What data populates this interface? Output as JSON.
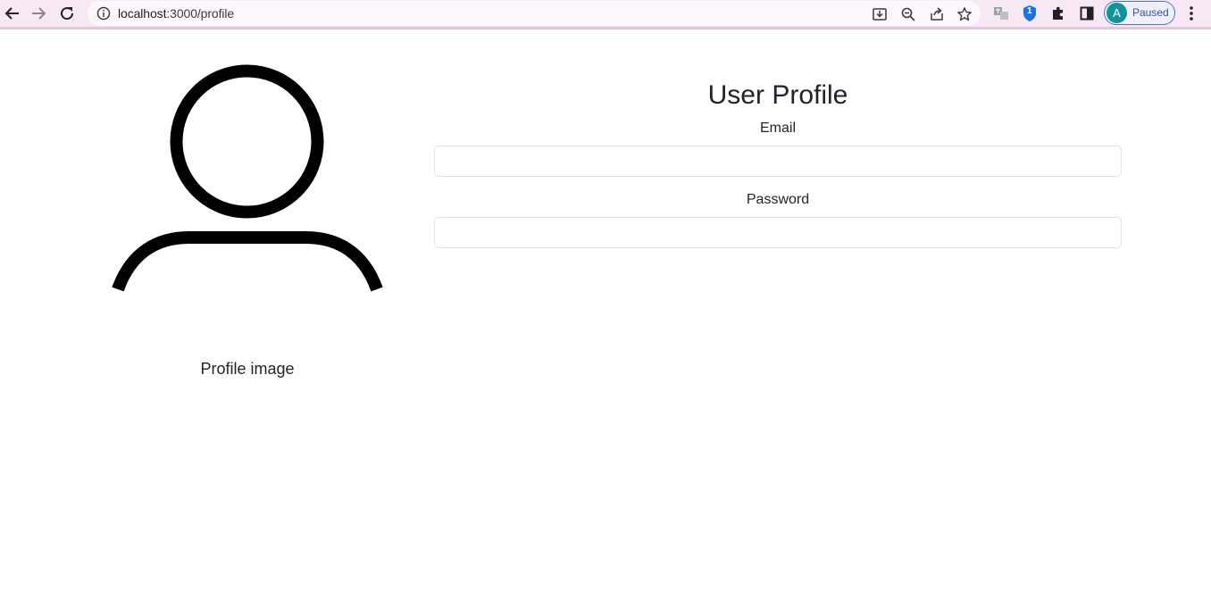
{
  "browser": {
    "url_host": "localhost",
    "url_path": ":3000/profile",
    "profile": {
      "initial": "A",
      "status": "Paused"
    },
    "extension_badge": "1"
  },
  "page": {
    "title": "User Profile",
    "profile_image_caption": "Profile image",
    "email_label": "Email",
    "email_value": "",
    "password_label": "Password",
    "password_value": ""
  },
  "icons": {
    "back": "arrow-left-icon",
    "forward": "arrow-right-icon",
    "reload": "reload-icon",
    "info": "info-icon",
    "install": "install-icon",
    "zoom": "zoom-out-icon",
    "share": "share-icon",
    "bookmark": "star-icon",
    "extension_translate": "translate-extension-icon",
    "extension_shield": "shield-extension-icon",
    "extensions": "puzzle-icon",
    "side_panel": "side-panel-icon",
    "menu": "kebab-menu-icon",
    "profile_image": "user-avatar-icon"
  },
  "colors": {
    "toolbar_bg": "#f6e8f4",
    "profile_avatar": "#12939a",
    "shield": "#1a73e8"
  }
}
